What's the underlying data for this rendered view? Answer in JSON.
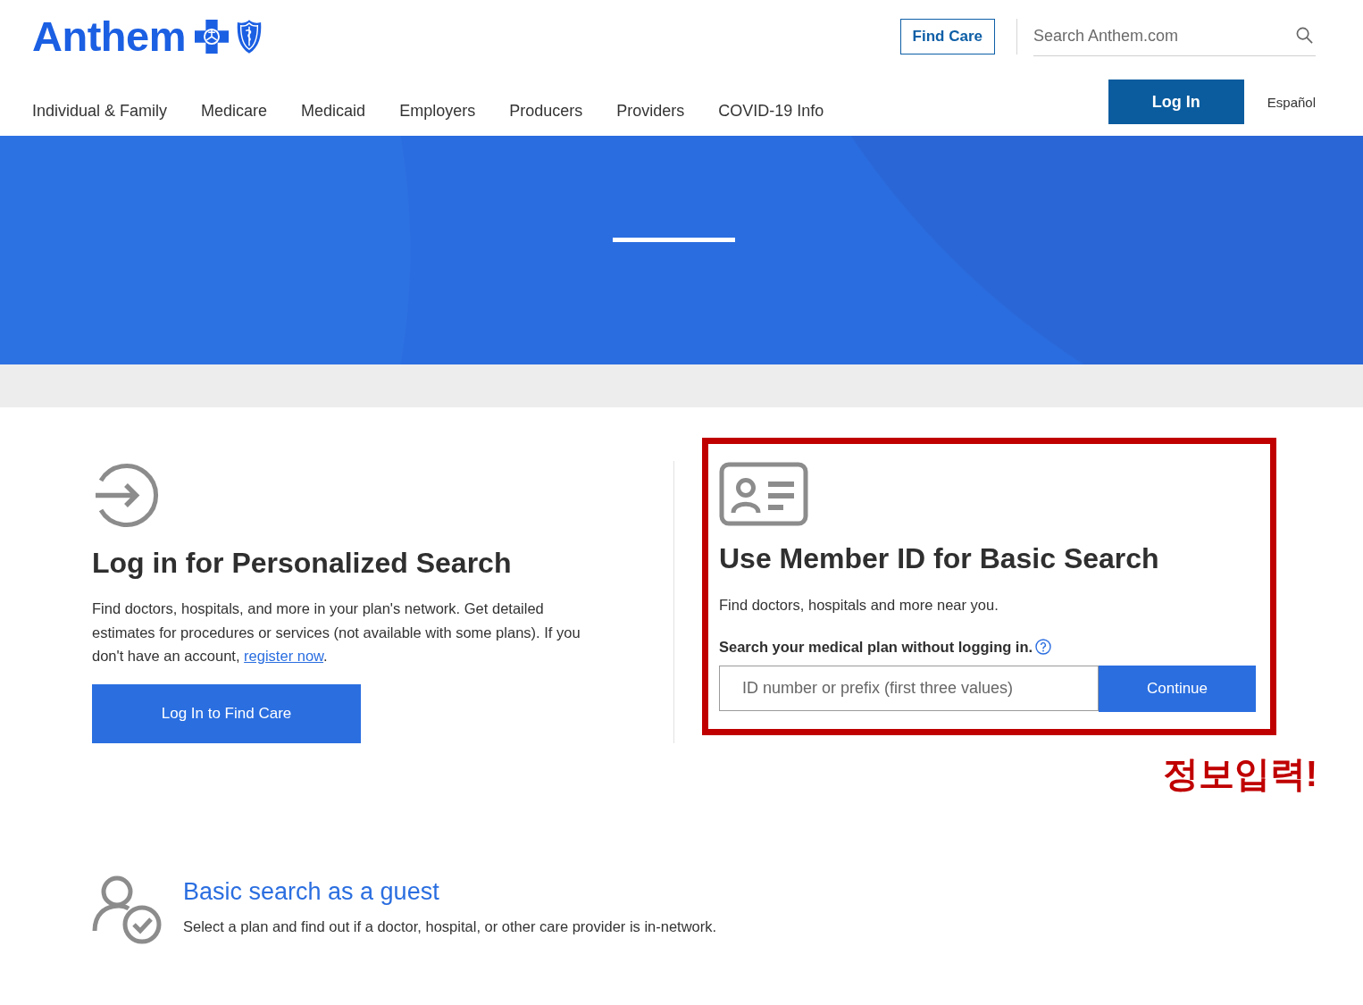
{
  "header": {
    "logo": {
      "wordmark": "Anthem"
    },
    "find_care_button": "Find Care",
    "search": {
      "placeholder": "Search Anthem.com"
    },
    "nav": [
      "Individual & Family",
      "Medicare",
      "Medicaid",
      "Employers",
      "Producers",
      "Providers",
      "COVID-19 Info"
    ],
    "login_button": "Log In",
    "language_link": "Español"
  },
  "login_search": {
    "title": "Log in for Personalized Search",
    "description": {
      "text": "Find doctors, hospitals, and more in your plan's network. Get detailed estimates for procedures or services (not available with some plans). If you don't have an account, ",
      "link": "register now",
      "text_after": "."
    },
    "button": "Log In to Find Care"
  },
  "member_search": {
    "highlighted": true,
    "title": "Use Member ID for Basic Search",
    "description": "Find doctors, hospitals and more near you.",
    "field_label": "Search your medical plan without logging in.",
    "input": {
      "placeholder": "ID number or prefix (first three values)"
    },
    "button": "Continue"
  },
  "annotation": {
    "text": "정보입력!"
  },
  "guest_search": {
    "title": "Basic search as a guest",
    "description": "Select a plan and find out if a doctor, hospital, or other care provider is in-network."
  }
}
